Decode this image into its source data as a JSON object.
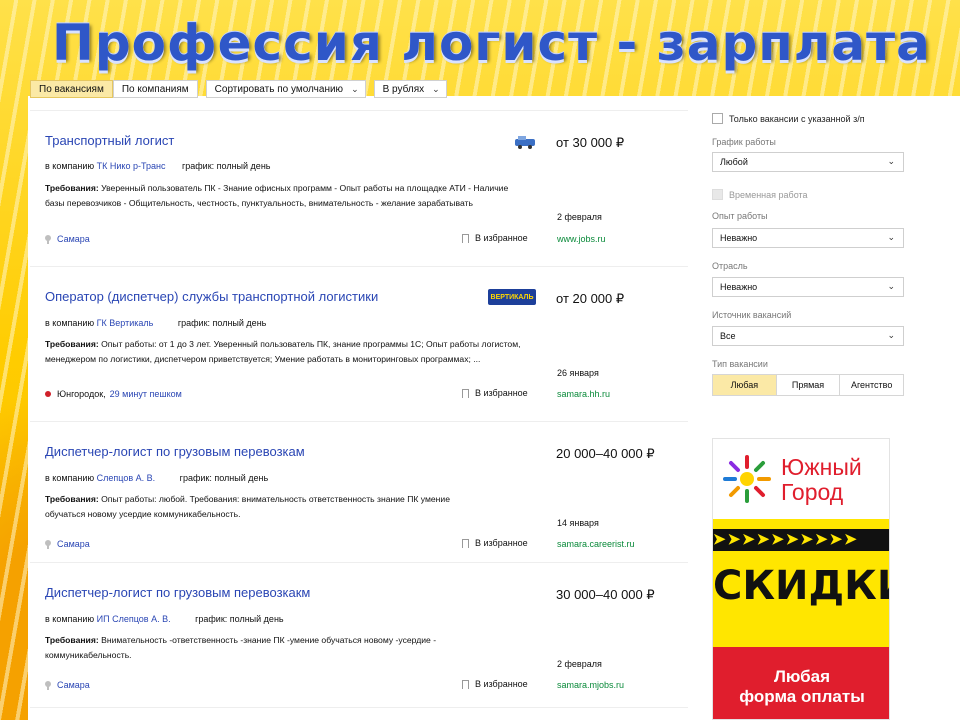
{
  "slide": {
    "title": "Профессия логист - зарплата"
  },
  "toolbar": {
    "tab_vacancies": "По вакансиям",
    "tab_companies": "По компаниям",
    "sort": "Сортировать по умолчанию",
    "currency": "В рублях"
  },
  "results": [
    {
      "title": "Транспортный логист",
      "salary": "от 30 000 ₽",
      "company_prefix": "в компанию",
      "company": "ТК Нико р-Транс",
      "schedule_label": "график:",
      "schedule": "полный день",
      "req_label": "Требования:",
      "requirements": "Уверенный пользователь ПК - Знание офисных программ - Опыт работы на площадке АТИ - Наличие базы перевозчиков - Общительность, честность, пунктуальность, внимательность - желание зарабатывать",
      "date": "2 февраля",
      "location": "Самара",
      "favorite": "В избранное",
      "source": "www.jobs.ru"
    },
    {
      "title": "Оператор (диспетчер) службы транспортной логистики",
      "salary": "от 20 000 ₽",
      "company_prefix": "в компанию",
      "company": "ГК Вертикаль",
      "schedule_label": "график:",
      "schedule": "полный день",
      "req_label": "Требования:",
      "requirements": "Опыт работы: от 1 до 3 лет. Уверенный пользователь ПК, знание программы 1С; Опыт работы логистом, менеджером по логистики, диспетчером приветствуется; Умение работать в мониторинговых программах; ...",
      "date": "26 января",
      "location": "Юнгородок,",
      "walk": "29 минут пешком",
      "favorite": "В избранное",
      "source": "samara.hh.ru",
      "logo_text": "ВЕРТИКАЛЬ"
    },
    {
      "title": "Диспетчер-логист по грузовым перевозкам",
      "salary": "20 000–40 000 ₽",
      "company_prefix": "в компанию",
      "company": "Слепцов А. В.",
      "schedule_label": "график:",
      "schedule": "полный день",
      "req_label": "Требования:",
      "requirements": "Опыт работы: любой. Требования: внимательность ответственность знание ПК умение обучаться новому усердие коммуникабельность.",
      "date": "14 января",
      "location": "Самара",
      "favorite": "В избранное",
      "source": "samara.careerist.ru"
    },
    {
      "title": "Диспетчер-логист по грузовым перевозкакм",
      "salary": "30 000–40 000 ₽",
      "company_prefix": "в компанию",
      "company": "ИП Слепцов А. В.",
      "schedule_label": "график:",
      "schedule": "полный день",
      "req_label": "Требования:",
      "requirements": "Внимательность -ответственность -знание ПК -умение обучаться новому -усердие - коммуникабельность.",
      "date": "2 февраля",
      "location": "Самара",
      "favorite": "В избранное",
      "source": "samara.mjobs.ru"
    }
  ],
  "filters": {
    "only_with_salary": "Только вакансии с указанной з/п",
    "schedule_label": "График работы",
    "schedule_value": "Любой",
    "temporary": "Временная работа",
    "experience_label": "Опыт работы",
    "experience_value": "Неважно",
    "industry_label": "Отрасль",
    "industry_value": "Неважно",
    "source_label": "Источник вакансий",
    "source_value": "Все",
    "type_label": "Тип вакансии",
    "type_options": [
      "Любая",
      "Прямая",
      "Агентство"
    ]
  },
  "ad": {
    "brand_line1": "Южный",
    "brand_line2": "Город",
    "stripe": "➤➤➤➤➤➤➤➤➤➤",
    "sale": "СКИДКИ",
    "pay_line1": "Любая",
    "pay_line2": "форма оплаты"
  },
  "colors": {
    "link": "#2a46b4",
    "source": "#0a8a3a",
    "accent": "#fbe9a6",
    "title": "#2f57c8"
  }
}
